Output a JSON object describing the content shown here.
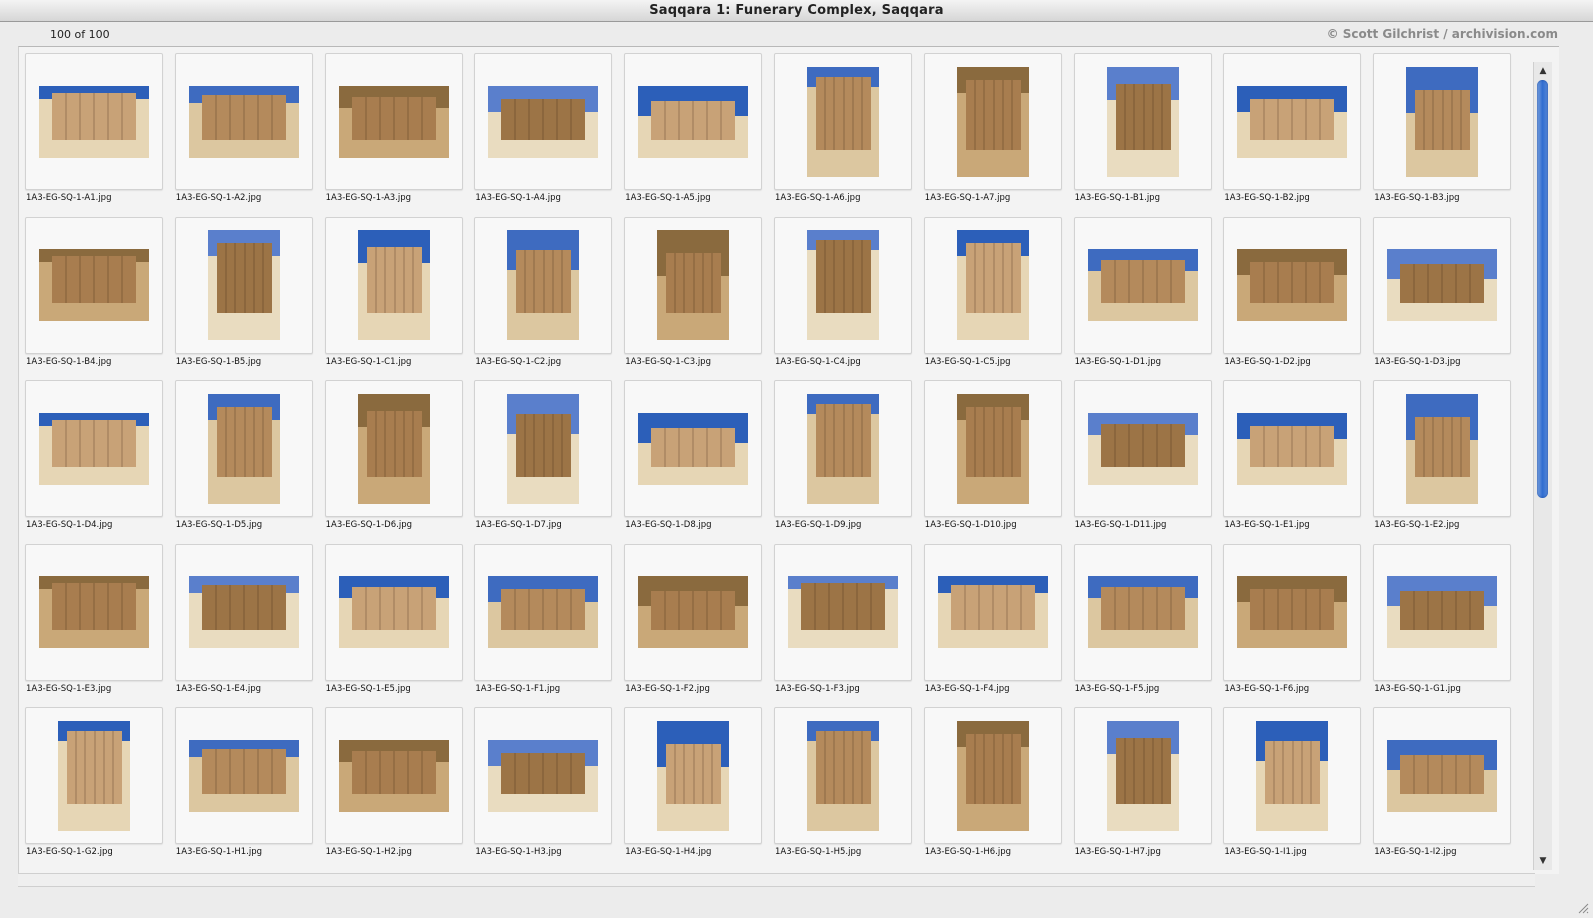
{
  "window": {
    "title": "Saqqara 1: Funerary Complex, Saqqara",
    "count_label": "100 of 100",
    "credit": "© Scott Gilchrist / archivision.com"
  },
  "icons": {
    "scroll_up": "scroll-up-arrow-icon",
    "scroll_down": "scroll-down-arrow-icon",
    "resize": "resize-grip-icon"
  },
  "colors": {
    "scroll_thumb": "#2f6cd0",
    "sky": "#2f5fb8",
    "sand": "#e8d8b4",
    "stone": "#a77f52"
  },
  "thumbnails": [
    {
      "file": "1A3-EG-SQ-1-A1.jpg",
      "orientation": "landscape"
    },
    {
      "file": "1A3-EG-SQ-1-A2.jpg",
      "orientation": "landscape"
    },
    {
      "file": "1A3-EG-SQ-1-A3.jpg",
      "orientation": "landscape"
    },
    {
      "file": "1A3-EG-SQ-1-A4.jpg",
      "orientation": "landscape"
    },
    {
      "file": "1A3-EG-SQ-1-A5.jpg",
      "orientation": "landscape"
    },
    {
      "file": "1A3-EG-SQ-1-A6.jpg",
      "orientation": "portrait"
    },
    {
      "file": "1A3-EG-SQ-1-A7.jpg",
      "orientation": "portrait"
    },
    {
      "file": "1A3-EG-SQ-1-B1.jpg",
      "orientation": "portrait"
    },
    {
      "file": "1A3-EG-SQ-1-B2.jpg",
      "orientation": "landscape"
    },
    {
      "file": "1A3-EG-SQ-1-B3.jpg",
      "orientation": "portrait"
    },
    {
      "file": "1A3-EG-SQ-1-B4.jpg",
      "orientation": "landscape"
    },
    {
      "file": "1A3-EG-SQ-1-B5.jpg",
      "orientation": "portrait"
    },
    {
      "file": "1A3-EG-SQ-1-C1.jpg",
      "orientation": "portrait"
    },
    {
      "file": "1A3-EG-SQ-1-C2.jpg",
      "orientation": "portrait"
    },
    {
      "file": "1A3-EG-SQ-1-C3.jpg",
      "orientation": "portrait"
    },
    {
      "file": "1A3-EG-SQ-1-C4.jpg",
      "orientation": "portrait"
    },
    {
      "file": "1A3-EG-SQ-1-C5.jpg",
      "orientation": "portrait"
    },
    {
      "file": "1A3-EG-SQ-1-D1.jpg",
      "orientation": "landscape"
    },
    {
      "file": "1A3-EG-SQ-1-D2.jpg",
      "orientation": "landscape"
    },
    {
      "file": "1A3-EG-SQ-1-D3.jpg",
      "orientation": "landscape"
    },
    {
      "file": "1A3-EG-SQ-1-D4.jpg",
      "orientation": "landscape"
    },
    {
      "file": "1A3-EG-SQ-1-D5.jpg",
      "orientation": "portrait"
    },
    {
      "file": "1A3-EG-SQ-1-D6.jpg",
      "orientation": "portrait"
    },
    {
      "file": "1A3-EG-SQ-1-D7.jpg",
      "orientation": "portrait"
    },
    {
      "file": "1A3-EG-SQ-1-D8.jpg",
      "orientation": "landscape"
    },
    {
      "file": "1A3-EG-SQ-1-D9.jpg",
      "orientation": "portrait"
    },
    {
      "file": "1A3-EG-SQ-1-D10.jpg",
      "orientation": "portrait"
    },
    {
      "file": "1A3-EG-SQ-1-D11.jpg",
      "orientation": "landscape"
    },
    {
      "file": "1A3-EG-SQ-1-E1.jpg",
      "orientation": "landscape"
    },
    {
      "file": "1A3-EG-SQ-1-E2.jpg",
      "orientation": "portrait"
    },
    {
      "file": "1A3-EG-SQ-1-E3.jpg",
      "orientation": "landscape"
    },
    {
      "file": "1A3-EG-SQ-1-E4.jpg",
      "orientation": "landscape"
    },
    {
      "file": "1A3-EG-SQ-1-E5.jpg",
      "orientation": "landscape"
    },
    {
      "file": "1A3-EG-SQ-1-F1.jpg",
      "orientation": "landscape"
    },
    {
      "file": "1A3-EG-SQ-1-F2.jpg",
      "orientation": "landscape"
    },
    {
      "file": "1A3-EG-SQ-1-F3.jpg",
      "orientation": "landscape"
    },
    {
      "file": "1A3-EG-SQ-1-F4.jpg",
      "orientation": "landscape"
    },
    {
      "file": "1A3-EG-SQ-1-F5.jpg",
      "orientation": "landscape"
    },
    {
      "file": "1A3-EG-SQ-1-F6.jpg",
      "orientation": "landscape"
    },
    {
      "file": "1A3-EG-SQ-1-G1.jpg",
      "orientation": "landscape"
    },
    {
      "file": "1A3-EG-SQ-1-G2.jpg",
      "orientation": "portrait"
    },
    {
      "file": "1A3-EG-SQ-1-H1.jpg",
      "orientation": "landscape"
    },
    {
      "file": "1A3-EG-SQ-1-H2.jpg",
      "orientation": "landscape"
    },
    {
      "file": "1A3-EG-SQ-1-H3.jpg",
      "orientation": "landscape"
    },
    {
      "file": "1A3-EG-SQ-1-H4.jpg",
      "orientation": "portrait"
    },
    {
      "file": "1A3-EG-SQ-1-H5.jpg",
      "orientation": "portrait"
    },
    {
      "file": "1A3-EG-SQ-1-H6.jpg",
      "orientation": "portrait"
    },
    {
      "file": "1A3-EG-SQ-1-H7.jpg",
      "orientation": "portrait"
    },
    {
      "file": "1A3-EG-SQ-1-I1.jpg",
      "orientation": "portrait"
    },
    {
      "file": "1A3-EG-SQ-1-I2.jpg",
      "orientation": "landscape"
    }
  ]
}
